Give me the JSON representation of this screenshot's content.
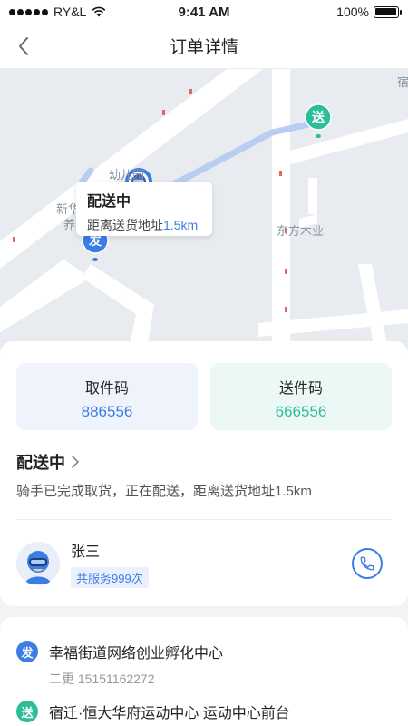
{
  "status_bar": {
    "carrier": "RY&L",
    "time": "9:41 AM",
    "battery": "100%"
  },
  "nav": {
    "title": "订单详情"
  },
  "map": {
    "bubble_title": "配送中",
    "bubble_prefix": "距离送货地址",
    "bubble_distance": "1.5km",
    "labels": {
      "kindergarten": "幼儿园",
      "committee": "新华居委会",
      "elderly": "养老服务",
      "furniture": "东方木业",
      "edge": "宿"
    },
    "send_marker": "发",
    "deliver_marker": "送"
  },
  "codes": {
    "pickup_label": "取件码",
    "pickup_value": "886556",
    "delivery_label": "送件码",
    "delivery_value": "666556"
  },
  "status": {
    "title": "配送中",
    "description": "骑手已完成取货，正在配送，距离送货地址1.5km"
  },
  "rider": {
    "name": "张三",
    "served": "共服务999次"
  },
  "addresses": [
    {
      "badge": "发",
      "name": "幸福街道网络创业孵化中心",
      "contact": "二更  15151162272"
    },
    {
      "badge": "送",
      "name": "宿迁·恒大华府运动中心 运动中心前台",
      "contact": ""
    }
  ],
  "colors": {
    "accent_blue": "#3b7de4",
    "accent_green": "#2bbf99"
  }
}
